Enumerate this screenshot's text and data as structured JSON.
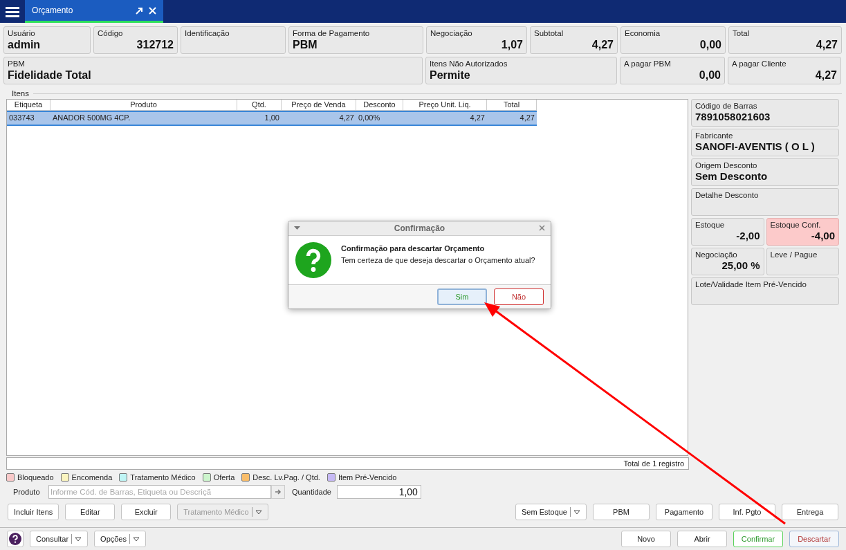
{
  "top_bar": {
    "tab": {
      "label": "Orçamento",
      "selected": true
    }
  },
  "summary_row_1": [
    {
      "label": "Usuário",
      "value": "admin",
      "kind": "text"
    },
    {
      "label": "Código",
      "value": "312712",
      "kind": "number"
    },
    {
      "label": "Identificação",
      "kind": "text"
    },
    {
      "label": "Forma de Pagamento",
      "value": "PBM",
      "kind": "text"
    },
    {
      "label": "Negociação",
      "value": "1,07",
      "kind": "number"
    },
    {
      "label": "Subtotal",
      "value": "4,27",
      "kind": "number"
    },
    {
      "label": "Economia",
      "value": "0,00",
      "kind": "number"
    },
    {
      "label": "Total",
      "value": "4,27",
      "kind": "number"
    }
  ],
  "summary_row_2": [
    {
      "label": "PBM",
      "value": "Fidelidade Total",
      "kind": "text"
    },
    {
      "label": "Itens Não Autorizados",
      "value": "Permite",
      "kind": "text"
    },
    {
      "label": "A pagar PBM",
      "value": "0,00",
      "kind": "number"
    },
    {
      "label": "A pagar Cliente",
      "value": "4,27",
      "kind": "number"
    }
  ],
  "items": {
    "title": "Itens",
    "columns": [
      "Etiqueta",
      "Produto",
      "Qtd.",
      "Preço de Venda",
      "Desconto",
      "Preço Unit. Liq.",
      "Total"
    ],
    "rows": [
      {
        "cells": [
          "033743",
          "ANADOR 500MG 4CP.",
          "1,00",
          "4,27",
          "0,00%",
          "4,27",
          "4,27"
        ],
        "selected": true
      }
    ],
    "footer": "Total de 1 registro"
  },
  "details": [
    {
      "cards": [
        {
          "label": "Código de Barras",
          "value": "7891058021603",
          "kind": "text",
          "alert": false
        }
      ]
    },
    {
      "cards": [
        {
          "label": "Fabricante",
          "value": "SANOFI-AVENTIS  ( O L )",
          "kind": "text",
          "alert": false
        }
      ]
    },
    {
      "cards": [
        {
          "label": "Origem Desconto",
          "value": "Sem Desconto",
          "kind": "text",
          "alert": false
        }
      ]
    },
    {
      "cards": [
        {
          "label": "Detalhe Desconto",
          "alert": false
        }
      ]
    },
    {
      "cards": [
        {
          "label": "Estoque",
          "value": "-2,00",
          "kind": "number",
          "alert": false
        },
        {
          "label": "Estoque Conf.",
          "value": "-4,00",
          "kind": "number",
          "alert": true
        }
      ]
    },
    {
      "cards": [
        {
          "label": "Negociação",
          "value": "25,00 %",
          "kind": "number",
          "alert": false
        },
        {
          "label": "Leve / Pague",
          "alert": false
        }
      ]
    },
    {
      "cards": [
        {
          "label": "Lote/Validade Item Pré-Vencido",
          "alert": false
        }
      ]
    }
  ],
  "legend": [
    {
      "label": "Bloqueado",
      "color": "#f9c9c9"
    },
    {
      "label": "Encomenda",
      "color": "#fbf5c0"
    },
    {
      "label": "Tratamento Médico",
      "color": "#bff5f5"
    },
    {
      "label": "Oferta",
      "color": "#cdf5cd"
    },
    {
      "label": "Desc. Lv.Pag. / Qtd.",
      "color": "#f9bd6a"
    },
    {
      "label": "Item Pré-Vencido",
      "color": "#c6b9f5"
    }
  ],
  "product_entry": {
    "label": "Produto",
    "placeholder": "Informe Cód. de Barras, Etiqueta ou Descriçã",
    "quantity_label": "Quantidade",
    "quantity": "1,00"
  },
  "item_actions": [
    {
      "label": "Incluir Itens",
      "disabled": false,
      "dropdown": false
    },
    {
      "label": "Editar",
      "disabled": false,
      "dropdown": false
    },
    {
      "label": "Excluir",
      "disabled": false,
      "dropdown": false
    },
    {
      "label": "Tratamento Médico",
      "disabled": true,
      "dropdown": true
    }
  ],
  "sale_actions": [
    {
      "label": "Sem Estoque",
      "dropdown": true
    },
    {
      "label": "PBM",
      "dropdown": false
    },
    {
      "label": "Pagamento",
      "dropdown": false
    },
    {
      "label": "Inf. Pgto",
      "dropdown": false
    },
    {
      "label": "Entrega",
      "dropdown": false
    }
  ],
  "bottom_left": [
    {
      "label": "Consultar"
    },
    {
      "label": "Opções"
    }
  ],
  "bottom_right": [
    {
      "label": "Novo",
      "kind": "default"
    },
    {
      "label": "Abrir",
      "kind": "default"
    },
    {
      "label": "Confirmar",
      "kind": "confirm"
    },
    {
      "label": "Descartar",
      "kind": "discard"
    }
  ],
  "dialog": {
    "title": "Confirmação",
    "heading": "Confirmação para descartar Orçamento",
    "message": "Tem certeza de que deseja descartar o Orçamento atual?",
    "buttons": [
      {
        "label": "Sim",
        "kind": "yes"
      },
      {
        "label": "Não",
        "kind": "no"
      }
    ]
  }
}
